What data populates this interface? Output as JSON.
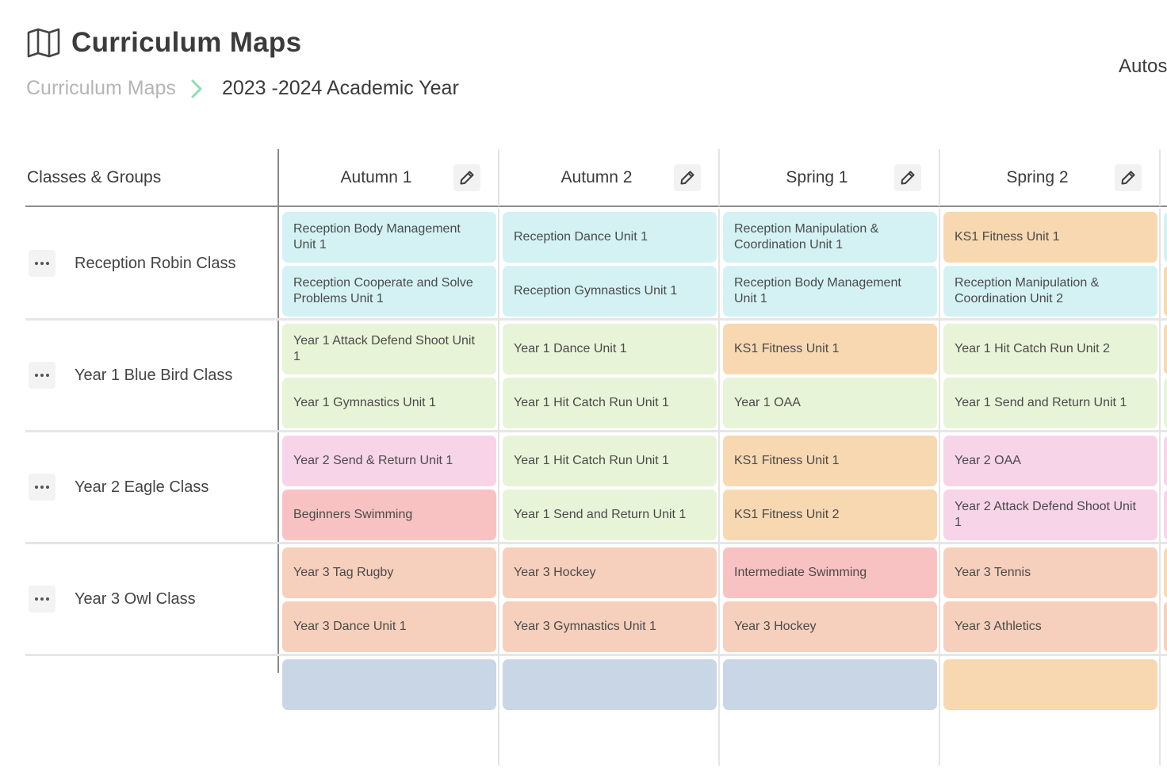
{
  "header": {
    "title": "Curriculum Maps",
    "title_icon": "map-icon",
    "breadcrumb": {
      "root": "Curriculum Maps",
      "separator_icon": "chevron-right-icon",
      "current": "2023 -2024 Academic Year"
    },
    "autosave_label": "Autos"
  },
  "colors": {
    "accent": "#8fdcb6",
    "reception": "#d4f2f4",
    "year1": "#e8f4d8",
    "ks1_fitness": "#f8d8b0",
    "year2": "#f8d4e8",
    "swimming": "#f9c2c2",
    "year3": "#f6d0bc"
  },
  "table": {
    "groups_header": "Classes & Groups",
    "terms": [
      {
        "label": "Autumn 1",
        "edit_icon": "pencil-icon"
      },
      {
        "label": "Autumn 2",
        "edit_icon": "pencil-icon"
      },
      {
        "label": "Spring 1",
        "edit_icon": "pencil-icon"
      },
      {
        "label": "Spring 2",
        "edit_icon": "pencil-icon"
      }
    ],
    "rows": [
      {
        "class_name": "Reception Robin Class",
        "menu_icon": "more-horizontal-icon",
        "cells": [
          [
            {
              "text": "Reception Body Management Unit 1",
              "color": "#d4f2f4"
            },
            {
              "text": "Reception Cooperate and Solve Problems Unit 1",
              "color": "#d4f2f4"
            }
          ],
          [
            {
              "text": "Reception Dance Unit 1",
              "color": "#d4f2f4"
            },
            {
              "text": "Reception Gymnastics Unit 1",
              "color": "#d4f2f4"
            }
          ],
          [
            {
              "text": "Reception Manipulation & Coordination Unit 1",
              "color": "#d4f2f4"
            },
            {
              "text": "Reception Body Management Unit 1",
              "color": "#d4f2f4"
            }
          ],
          [
            {
              "text": "KS1 Fitness Unit 1",
              "color": "#f8d8b0"
            },
            {
              "text": "Reception Manipulation & Coordination Unit 2",
              "color": "#d4f2f4"
            }
          ]
        ]
      },
      {
        "class_name": "Year 1 Blue Bird Class",
        "menu_icon": "more-horizontal-icon",
        "cells": [
          [
            {
              "text": "Year 1 Attack Defend Shoot Unit 1",
              "color": "#e8f4d8"
            },
            {
              "text": "Year 1 Gymnastics Unit 1",
              "color": "#e8f4d8"
            }
          ],
          [
            {
              "text": "Year 1 Dance Unit 1",
              "color": "#e8f4d8"
            },
            {
              "text": "Year 1 Hit Catch Run Unit 1",
              "color": "#e8f4d8"
            }
          ],
          [
            {
              "text": "KS1 Fitness Unit 1",
              "color": "#f8d8b0"
            },
            {
              "text": "Year 1 OAA",
              "color": "#e8f4d8"
            }
          ],
          [
            {
              "text": "Year 1 Hit Catch Run Unit 2",
              "color": "#e8f4d8"
            },
            {
              "text": "Year 1 Send and Return Unit 1",
              "color": "#e8f4d8"
            }
          ]
        ]
      },
      {
        "class_name": "Year 2 Eagle Class",
        "menu_icon": "more-horizontal-icon",
        "cells": [
          [
            {
              "text": "Year 2 Send & Return Unit 1",
              "color": "#f8d4e8"
            },
            {
              "text": "Beginners Swimming",
              "color": "#f9c2c2"
            }
          ],
          [
            {
              "text": "Year 1 Hit Catch Run Unit 1",
              "color": "#e8f4d8"
            },
            {
              "text": "Year 1 Send and Return Unit 1",
              "color": "#e8f4d8"
            }
          ],
          [
            {
              "text": "KS1 Fitness Unit 1",
              "color": "#f8d8b0"
            },
            {
              "text": "KS1 Fitness Unit 2",
              "color": "#f8d8b0"
            }
          ],
          [
            {
              "text": "Year 2 OAA",
              "color": "#f8d4e8"
            },
            {
              "text": "Year 2 Attack Defend Shoot Unit 1",
              "color": "#f8d4e8"
            }
          ]
        ]
      },
      {
        "class_name": "Year 3 Owl Class",
        "menu_icon": "more-horizontal-icon",
        "cells": [
          [
            {
              "text": "Year 3 Tag Rugby",
              "color": "#f6d0bc"
            },
            {
              "text": "Year 3 Dance Unit 1",
              "color": "#f6d0bc"
            }
          ],
          [
            {
              "text": "Year 3 Hockey",
              "color": "#f6d0bc"
            },
            {
              "text": "Year 3 Gymnastics Unit 1",
              "color": "#f6d0bc"
            }
          ],
          [
            {
              "text": "Intermediate Swimming",
              "color": "#f9c2c2"
            },
            {
              "text": "Year 3 Hockey",
              "color": "#f6d0bc"
            }
          ],
          [
            {
              "text": "Year 3 Tennis",
              "color": "#f6d0bc"
            },
            {
              "text": "Year 3 Athletics",
              "color": "#f6d0bc"
            }
          ]
        ]
      }
    ],
    "overflow_column_colors": [
      [
        "#d4f2f4",
        "#f8d8b0"
      ],
      [
        "#f8d8b0",
        "#e8f4d8"
      ],
      [
        "#f8d4e8",
        "#f8d4e8"
      ],
      [
        "#f8d8b0",
        "#f6d0bc"
      ]
    ],
    "next_row_colors": [
      "#c9d6e6",
      "#c9d6e6",
      "#c9d6e6",
      "#f8d8b0"
    ]
  }
}
